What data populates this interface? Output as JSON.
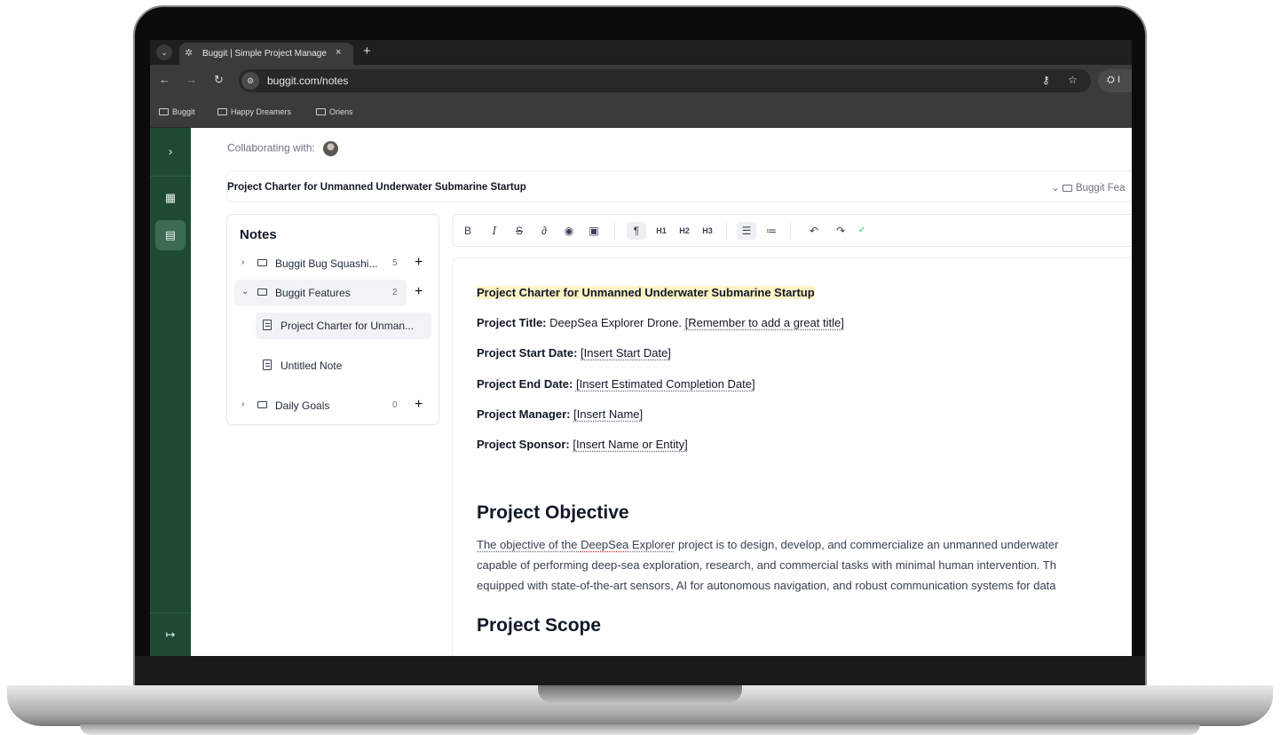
{
  "browser": {
    "tab_title": "Buggit | Simple Project Manage",
    "close_glyph": "×",
    "new_tab_glyph": "+",
    "url": "buggit.com/notes",
    "incognito_label": "I",
    "bookmarks": [
      "Buggit",
      "Happy Dreamers",
      "Oriens"
    ]
  },
  "app": {
    "collaborating_label": "Collaborating with:",
    "document_title": "Project Charter for Unmanned Underwater Submarine Startup",
    "folder_selector": "Buggit Fea",
    "rail": {
      "expand_glyph": "›",
      "grid_glyph": "▦",
      "notes_glyph": "▤",
      "logout_glyph": "↦"
    }
  },
  "notes": {
    "heading": "Notes",
    "folders": [
      {
        "label": "Buggit Bug Squashi...",
        "count": "5",
        "caret": "›"
      },
      {
        "label": "Buggit Features",
        "count": "2",
        "caret": "⌄"
      },
      {
        "label": "Daily Goals",
        "count": "0",
        "caret": "›"
      }
    ],
    "add_glyph": "+",
    "items": [
      {
        "label": "Project Charter for Unman..."
      },
      {
        "label": "Untitled Note"
      }
    ]
  },
  "toolbar": {
    "bold": "B",
    "italic": "I",
    "strike": "S",
    "link": "∂",
    "palette": "◉",
    "image": "▣",
    "paragraph": "¶",
    "h1": "H1",
    "h2": "H2",
    "h3": "H3",
    "bullet_list": "☰",
    "ordered_list": "≔",
    "undo": "↶",
    "redo": "↷",
    "saved": "✓"
  },
  "document": {
    "heading_line": "Project Charter for Unmanned Underwater Submarine Startup",
    "fields": [
      {
        "label": "Project Title:",
        "value": "DeepSea Explorer Drone.",
        "placeholder": "[Remember to add a great title]"
      },
      {
        "label": "Project Start Date:",
        "value": "",
        "placeholder": "[Insert Start Date]"
      },
      {
        "label": "Project End Date:",
        "value": "",
        "placeholder": "[Insert Estimated Completion Date]"
      },
      {
        "label": "Project Manager:",
        "value": "",
        "placeholder": "[Insert Name]"
      },
      {
        "label": "Project Sponsor:",
        "value": "",
        "placeholder": "[Insert Name or Entity]"
      }
    ],
    "objective_heading": "Project Objective",
    "objective_lines": [
      {
        "pre": "The objective of the ",
        "brand": "DeepSea",
        "mid": " Explorer",
        "post": " project is to design, develop, and commercialize an unmanned underwater"
      },
      "capable of performing deep-sea exploration, research, and commercial tasks with minimal human intervention. Th",
      "equipped with state-of-the-art sensors, AI for autonomous navigation, and robust communication systems for data"
    ],
    "scope_heading": "Project Scope"
  }
}
